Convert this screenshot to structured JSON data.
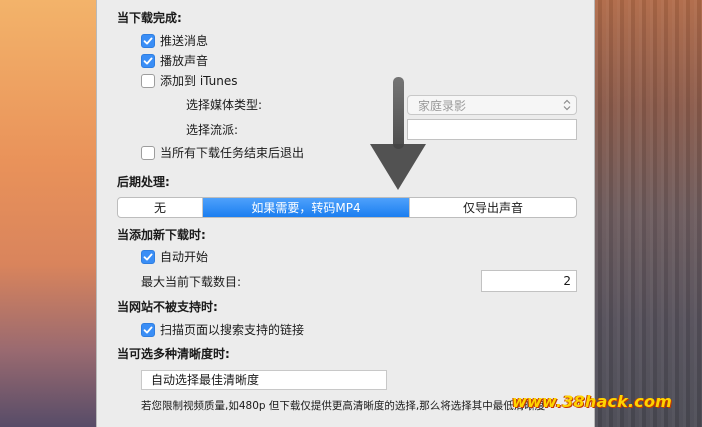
{
  "download_complete": {
    "heading": "当下载完成:",
    "items": [
      {
        "label": "推送消息",
        "checked": true
      },
      {
        "label": "播放声音",
        "checked": true
      },
      {
        "label": "添加到 iTunes",
        "checked": false
      }
    ],
    "media_type_label": "选择媒体类型:",
    "media_type_value": "家庭录影",
    "genre_label": "选择流派:",
    "genre_value": "",
    "quit_label": "当所有下载任务结束后退出",
    "quit_checked": false
  },
  "post_processing": {
    "heading": "后期处理:",
    "options": [
      "无",
      "如果需要，转码MP4",
      "仅导出声音"
    ],
    "selected_index": 1
  },
  "new_download": {
    "heading": "当添加新下载时:",
    "auto_start_label": "自动开始",
    "auto_start_checked": true,
    "max_label": "最大当前下载数目:",
    "max_value": "2"
  },
  "unsupported_site": {
    "heading": "当网站不被支持时:",
    "scan_label": "扫描页面以搜索支持的链接",
    "scan_checked": true
  },
  "quality": {
    "heading": "当可选多种清晰度时:",
    "selected": "自动选择最佳清晰度",
    "note": "若您限制视频质量,如480p 但下载仅提供更高清晰度的选择,那么将选择其中最低清晰度"
  },
  "watermark": "www.38hack.com",
  "colors": {
    "accent": "#1b7ef0",
    "panel": "#ececec",
    "overlay_arrow": "#4d4d4d"
  }
}
